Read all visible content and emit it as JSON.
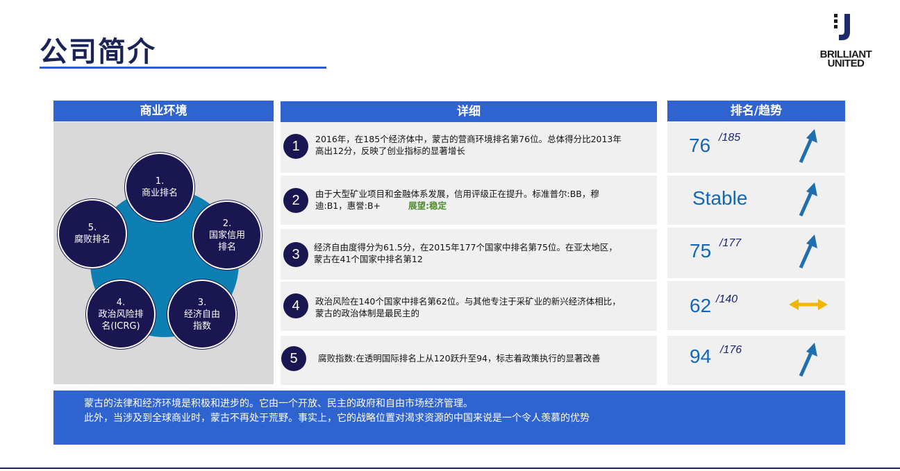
{
  "page": {
    "title": "公司简介"
  },
  "logo": {
    "line1": "BRILLIANT",
    "line2": "UNITED"
  },
  "headers": {
    "env": "商业环境",
    "detail": "详细",
    "rank": "排名/趋势"
  },
  "cycle": [
    {
      "num": "1.",
      "lines": [
        "商业排名"
      ]
    },
    {
      "num": "2.",
      "lines": [
        "国家信用",
        "排名"
      ]
    },
    {
      "num": "3.",
      "lines": [
        "经济自由",
        "指数"
      ]
    },
    {
      "num": "4.",
      "lines": [
        "政治风险排",
        "名(ICRG)"
      ]
    },
    {
      "num": "5.",
      "lines": [
        "腐败排名"
      ]
    }
  ],
  "rows": [
    {
      "num": "1",
      "line1": "2016年，在185个经济体中，蒙古的营商环境排名第76位。总体得分比2013年",
      "line2": "高出12分，反映了创业指标的显著增长"
    },
    {
      "num": "2",
      "line1": "由于大型矿业项目和金融体系发展，信用评级正在提升。标准普尔:BB，穆",
      "line2": "迪:B1，惠誉:B+",
      "outlook": "展望:稳定"
    },
    {
      "num": "3",
      "line1": "经济自由度得分为61.5分，在2015年177个国家中排名第75位。在亚太地区，",
      "line2": "蒙古在41个国家中排名第12"
    },
    {
      "num": "4",
      "line1": "政治风险在140个国家中排名第62位。与其他专注于采矿业的新兴经济体相比，",
      "line2": "蒙古的政治体制是最民主的"
    },
    {
      "num": "5",
      "line1": "腐败指数:在透明国际排名上从120跃升至94，标志着政策执行的显著改善",
      "line2": ""
    }
  ],
  "ranks": [
    {
      "value": "76",
      "denominator": "/185",
      "trend": "up"
    },
    {
      "value": "Stable",
      "denominator": "",
      "trend": "up"
    },
    {
      "value": "75",
      "denominator": "/177",
      "trend": "up"
    },
    {
      "value": "62",
      "denominator": "/140",
      "trend": "flat"
    },
    {
      "value": "94",
      "denominator": "/176",
      "trend": "up"
    }
  ],
  "footer": {
    "line1": "蒙古的法律和经济环境是积极和进步的。它由一个开放、民主的政府和自由市场经济管理。",
    "line2": "此外，当涉及到全球商业时，蒙古不再处于荒野。事实上，它的战略位置对渴求资源的中国来说是一个令人羡慕的优势"
  },
  "colors": {
    "navy": "#1a1651",
    "blue": "#2f63d0",
    "teal": "#0e7fb3",
    "arrow_up": "#1f6fb0",
    "arrow_flat": "#f3b600"
  }
}
